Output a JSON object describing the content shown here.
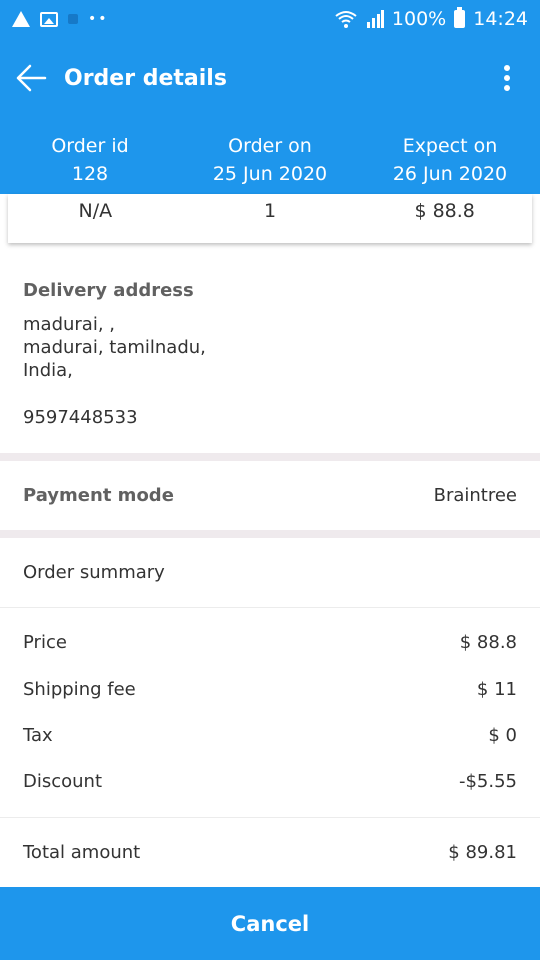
{
  "status_bar": {
    "battery": "100%",
    "time": "14:24",
    "icons": [
      "warning-icon",
      "image-icon",
      "app-icon",
      "dots-icon",
      "wifi-icon",
      "signal-icon",
      "battery-icon"
    ]
  },
  "app_bar": {
    "title": "Order details"
  },
  "order_info": {
    "id_label": "Order id",
    "id_value": "128",
    "on_label": "Order on",
    "on_value": "25 Jun 2020",
    "expect_label": "Expect on",
    "expect_value": "26 Jun 2020"
  },
  "values_row": {
    "col1": "N/A",
    "col2": "1",
    "col3": "$ 88.8"
  },
  "delivery": {
    "label": "Delivery address",
    "line1": "madurai, ,",
    "line2": "madurai, tamilnadu,",
    "line3": "India,",
    "phone": "9597448533"
  },
  "payment": {
    "label": "Payment mode",
    "value": "Braintree"
  },
  "summary": {
    "title": "Order summary",
    "price_label": "Price",
    "price_value": "$ 88.8",
    "shipping_label": "Shipping fee",
    "shipping_value": "$ 11",
    "tax_label": "Tax",
    "tax_value": "$ 0",
    "discount_label": "Discount",
    "discount_value": "-$5.55",
    "total_label": "Total amount",
    "total_value": "$ 89.81"
  },
  "cancel_label": "Cancel",
  "colors": {
    "primary": "#1e96ec",
    "divider": "#efeaed"
  }
}
